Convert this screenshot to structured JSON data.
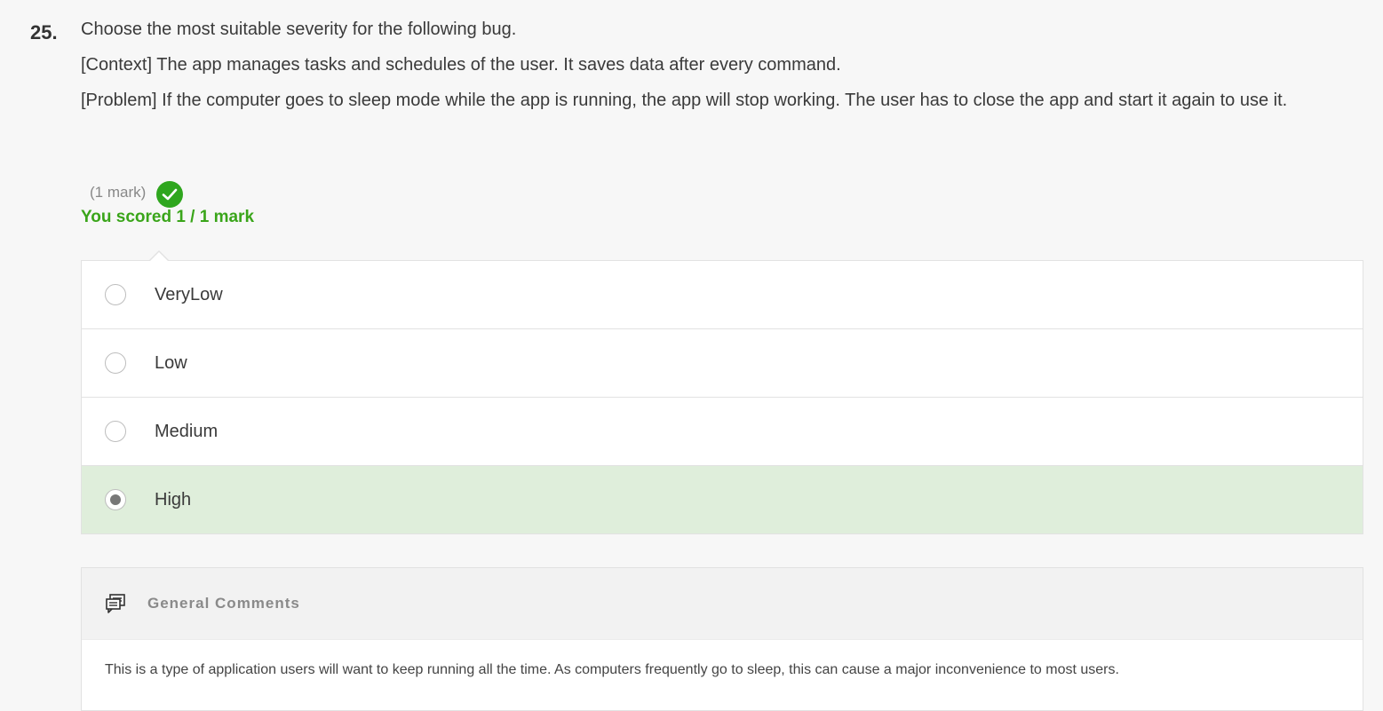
{
  "question": {
    "number": "25.",
    "prompt": "Choose the most suitable severity for the following bug.",
    "context": "[Context] The app manages tasks and schedules of the user. It saves data after every command.",
    "problem": "[Problem] If the computer goes to sleep mode while the app is running, the app will stop working. The user has to close the app and start it again to use it."
  },
  "score": {
    "mark_label": "(1 mark)",
    "result_text": "You scored 1 / 1 mark",
    "status_icon": "check-circle-icon",
    "status_color": "#2fa61e"
  },
  "options": [
    {
      "label": "VeryLow",
      "selected": false
    },
    {
      "label": "Low",
      "selected": false
    },
    {
      "label": "Medium",
      "selected": false
    },
    {
      "label": "High",
      "selected": true
    }
  ],
  "comments": {
    "title": "General Comments",
    "icon": "comments-icon",
    "text": "This is a type of application users will want to keep running all the time. As computers frequently go to sleep, this can cause a major inconvenience to most users."
  },
  "colors": {
    "selected_background": "#dfeedb",
    "score_text": "#3aa51a"
  }
}
